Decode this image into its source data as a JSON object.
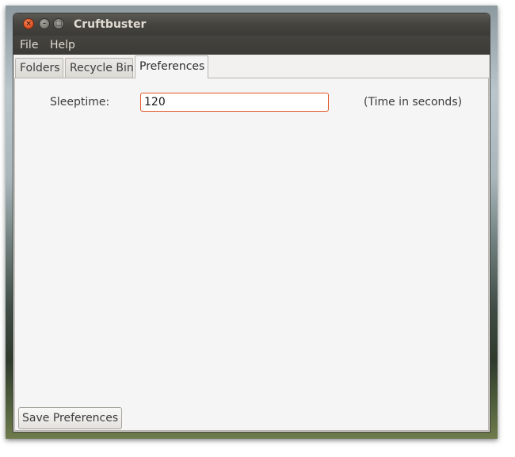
{
  "window": {
    "title": "Cruftbuster",
    "controls": {
      "close": "×",
      "minimize": "–",
      "maximize": "□"
    }
  },
  "menubar": {
    "items": [
      "File",
      "Help"
    ]
  },
  "tabs": [
    {
      "label": "Folders",
      "active": false
    },
    {
      "label": "Recycle Bin",
      "active": false
    },
    {
      "label": "Preferences",
      "active": true
    }
  ],
  "preferences": {
    "sleeptime_label": "Sleeptime:",
    "sleeptime_value": "120",
    "sleeptime_hint": "(Time in seconds)",
    "save_label": "Save Preferences"
  },
  "colors": {
    "accent": "#e2572a",
    "titlebar": "#3c3b37",
    "window_bg": "#f2f1f0"
  }
}
